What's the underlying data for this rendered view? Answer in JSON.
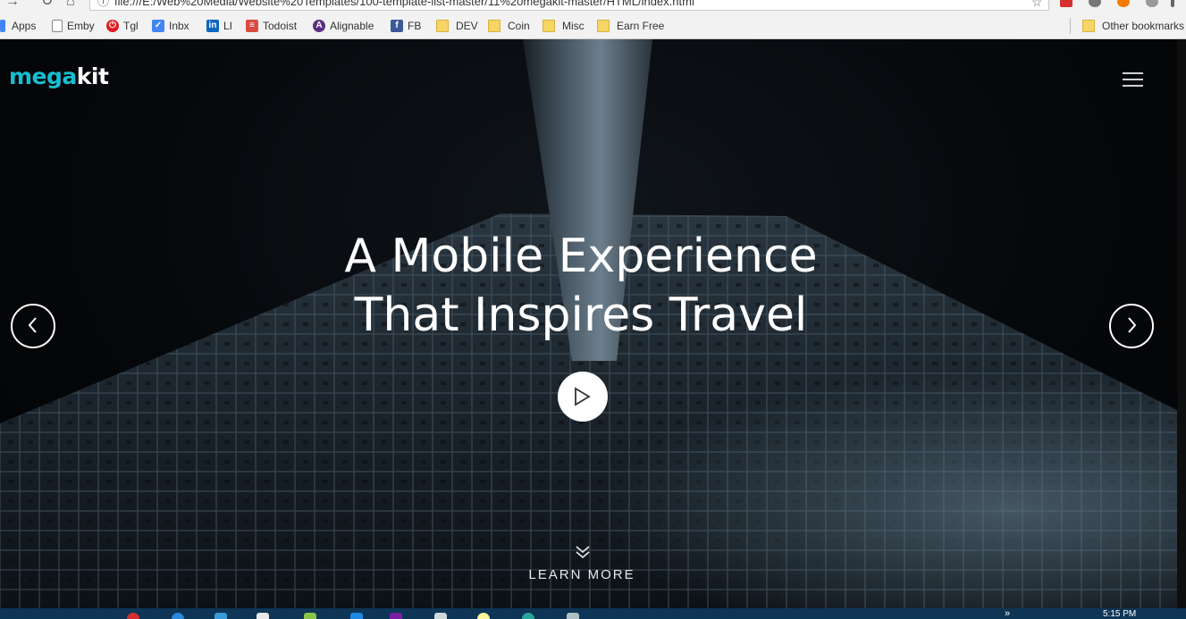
{
  "browser": {
    "url": "file:///E:/Web%20Media/Website%20Templates/100-template-list-master/11%20megakit-master/HTML/index.html",
    "bookmarks": [
      {
        "label": "Apps",
        "icon": "apps-grid-icon",
        "color": "#4285f4"
      },
      {
        "label": "Emby",
        "icon": "page-icon",
        "color": "#ffffff"
      },
      {
        "label": "Tgl",
        "icon": "toggl-icon",
        "color": "#e01b22"
      },
      {
        "label": "Inbx",
        "icon": "inbox-icon",
        "color": "#4285f4"
      },
      {
        "label": "LI",
        "icon": "linkedin-icon",
        "color": "#0a66c2"
      },
      {
        "label": "Todoist",
        "icon": "todoist-icon",
        "color": "#db4c3f"
      },
      {
        "label": "Alignable",
        "icon": "alignable-icon",
        "color": "#5a2d82"
      },
      {
        "label": "FB",
        "icon": "facebook-icon",
        "color": "#3b5998"
      },
      {
        "label": "DEV",
        "icon": "folder-icon",
        "color": "#f7d565"
      },
      {
        "label": "Coin",
        "icon": "folder-icon",
        "color": "#f7d565"
      },
      {
        "label": "Misc",
        "icon": "folder-icon",
        "color": "#f7d565"
      },
      {
        "label": "Earn Free",
        "icon": "folder-icon",
        "color": "#f7d565"
      }
    ],
    "other_bookmarks": "Other bookmarks"
  },
  "site": {
    "logo_part1": "mega",
    "logo_part2": "kit",
    "logo_color": "#17bed2",
    "headline_line1": "A Mobile Experience",
    "headline_line2": "That Inspires Travel",
    "prev_icon": "chevron-left-icon",
    "next_icon": "chevron-right-icon",
    "play_icon": "play-icon",
    "learn_more": "LEARN MORE"
  },
  "taskbar": {
    "time": "5:15 PM",
    "overflow_label": "»"
  }
}
